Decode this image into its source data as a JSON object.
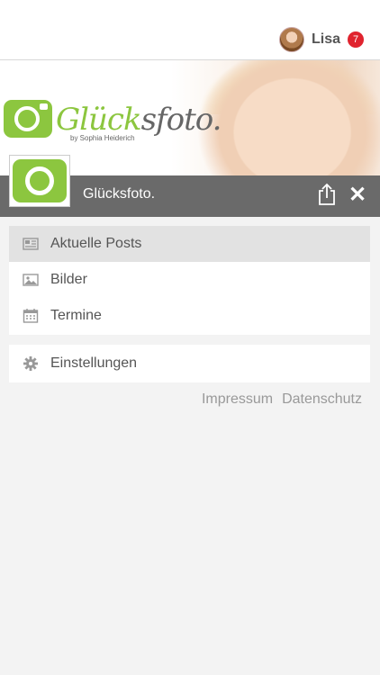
{
  "header": {
    "user_name": "Lisa",
    "notification_count": "7"
  },
  "banner": {
    "brand_part1": "Glück",
    "brand_part2": "sfoto.",
    "byline": "by Sophia Heiderich"
  },
  "titlebar": {
    "title": "Glücksfoto.",
    "close_glyph": "✕"
  },
  "menu": {
    "items": [
      {
        "label": "Aktuelle Posts",
        "icon": "newspaper-icon",
        "active": true
      },
      {
        "label": "Bilder",
        "icon": "image-icon",
        "active": false
      },
      {
        "label": "Termine",
        "icon": "calendar-icon",
        "active": false
      }
    ],
    "settings": {
      "label": "Einstellungen",
      "icon": "gear-icon"
    }
  },
  "footer_links": {
    "impressum": "Impressum",
    "datenschutz": "Datenschutz"
  },
  "colors": {
    "brand_green": "#8cc63f",
    "titlebar_gray": "#6a6a6a",
    "badge_red": "#e0232e"
  }
}
